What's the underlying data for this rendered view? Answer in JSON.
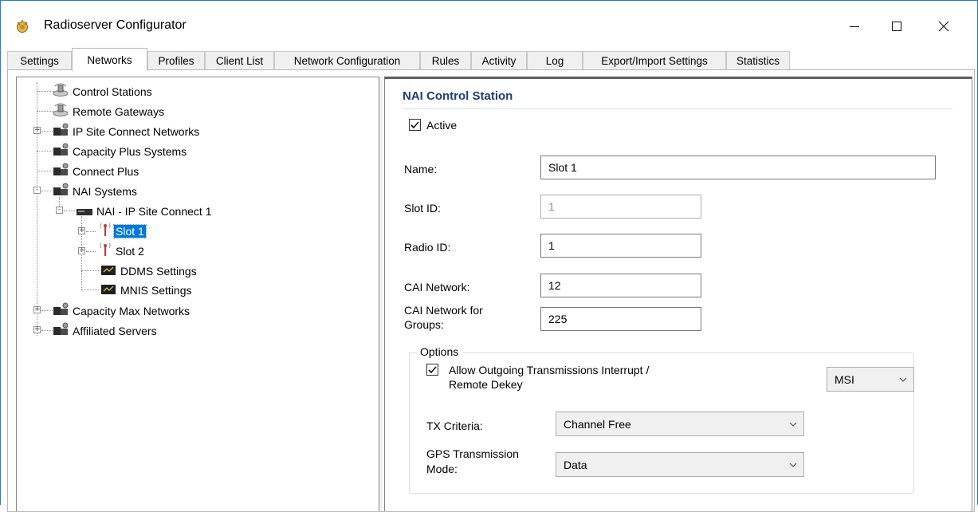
{
  "window": {
    "title": "Radioserver Configurator"
  },
  "tabs": [
    {
      "label": "Settings"
    },
    {
      "label": "Networks",
      "active": true
    },
    {
      "label": "Profiles"
    },
    {
      "label": "Client List"
    },
    {
      "label": "Network Configuration"
    },
    {
      "label": "Rules"
    },
    {
      "label": "Activity"
    },
    {
      "label": "Log"
    },
    {
      "label": "Export/Import Settings"
    },
    {
      "label": "Statistics"
    }
  ],
  "tree": [
    {
      "label": "Control Stations",
      "icon": "control-station-icon"
    },
    {
      "label": "Remote Gateways",
      "icon": "remote-gateway-icon"
    },
    {
      "label": "IP Site Connect Networks",
      "icon": "network-icon",
      "expander": "+"
    },
    {
      "label": "Capacity Plus Systems",
      "icon": "network-icon"
    },
    {
      "label": "Connect Plus",
      "icon": "network-icon"
    },
    {
      "label": "NAI Systems",
      "icon": "network-icon",
      "expander": "-"
    },
    {
      "label": "NAI - IP Site Connect 1",
      "icon": "repeater-icon",
      "expander": "-"
    },
    {
      "label": "Slot 1",
      "icon": "antenna-icon",
      "expander": "+",
      "selected": true
    },
    {
      "label": "Slot 2",
      "icon": "antenna-icon",
      "expander": "+"
    },
    {
      "label": "DDMS Settings",
      "icon": "settings-module-icon"
    },
    {
      "label": "MNIS Settings",
      "icon": "settings-module-icon"
    },
    {
      "label": "Capacity Max Networks",
      "icon": "network-icon",
      "expander": "+"
    },
    {
      "label": "Affiliated Servers",
      "icon": "network-icon",
      "expander": "+"
    }
  ],
  "form": {
    "section_title": "NAI Control Station",
    "active_label": "Active",
    "active_checked": true,
    "name_label": "Name:",
    "name_value": "Slot 1",
    "slot_id_label": "Slot ID:",
    "slot_id_value": "1",
    "radio_id_label": "Radio ID:",
    "radio_id_value": "1",
    "cai_network_label": "CAI Network:",
    "cai_network_value": "12",
    "cai_groups_label_line1": "CAI Network for",
    "cai_groups_label_line2": "Groups:",
    "cai_groups_value": "225",
    "options_legend": "Options",
    "allow_interrupt_line1": "Allow Outgoing Transmissions Interrupt /",
    "allow_interrupt_line2": "Remote Dekey",
    "allow_interrupt_checked": true,
    "interrupt_method_value": "MSI",
    "tx_criteria_label": "TX Criteria:",
    "tx_criteria_value": "Channel Free",
    "gps_mode_label_line1": "GPS Transmission",
    "gps_mode_label_line2": "Mode:",
    "gps_mode_value": "Data"
  },
  "colors": {
    "accent": "#0078d7",
    "section_title": "#1e3d78",
    "window_border": "#2b79d0"
  }
}
